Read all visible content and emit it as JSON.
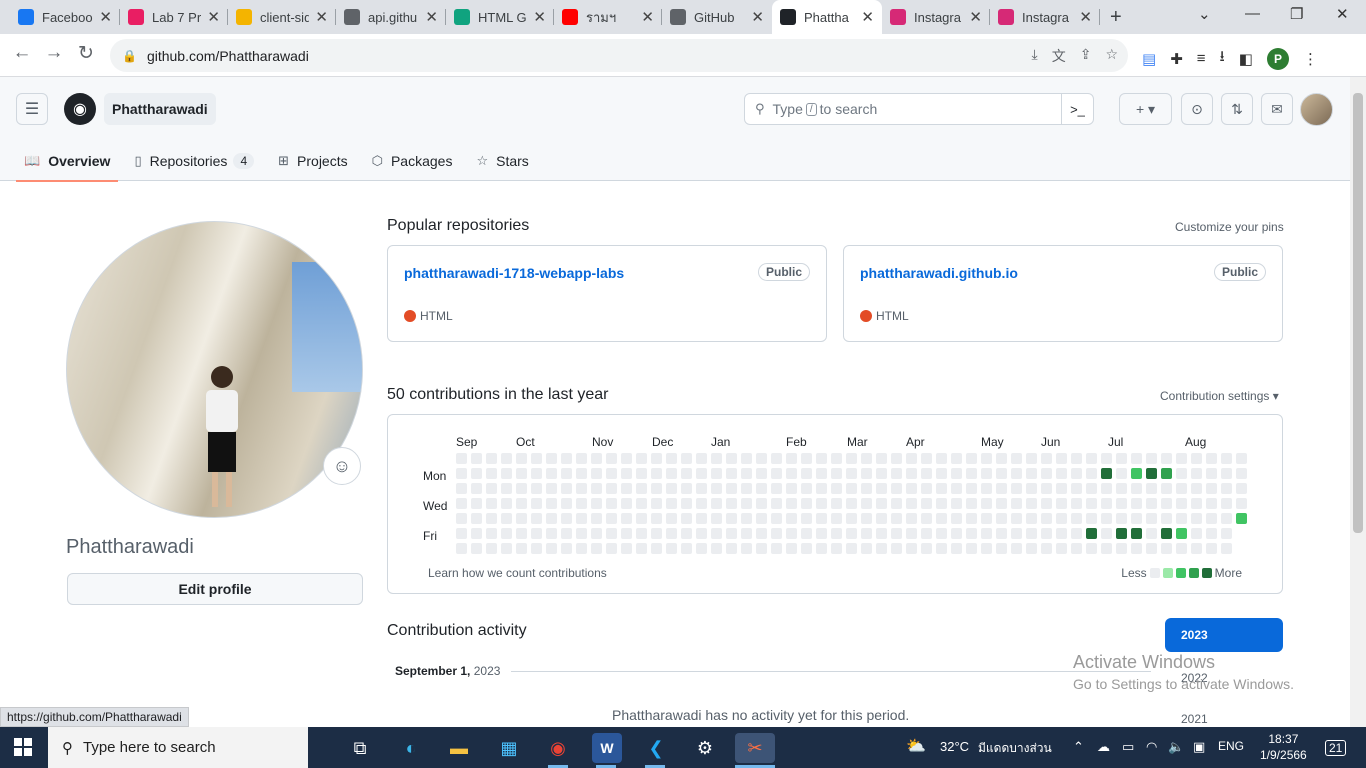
{
  "browser": {
    "tabs": [
      {
        "title": "Faceboo",
        "favicon": "facebook-icon",
        "color": "#1877f2"
      },
      {
        "title": "Lab 7 Pr",
        "favicon": "lab-icon",
        "color": "#e91e63"
      },
      {
        "title": "client-sid",
        "favicon": "slides-icon",
        "color": "#f4b400"
      },
      {
        "title": "api.githu",
        "favicon": "globe-icon",
        "color": "#5f6368"
      },
      {
        "title": "HTML G",
        "favicon": "chatgpt-icon",
        "color": "#10a37f"
      },
      {
        "title": "รามฯ",
        "favicon": "youtube-icon",
        "color": "#ff0000"
      },
      {
        "title": "GitHub",
        "favicon": "globe-icon",
        "color": "#5f6368"
      },
      {
        "title": "Phattha",
        "favicon": "github-icon",
        "color": "#1f2328"
      },
      {
        "title": "Instagra",
        "favicon": "instagram-icon",
        "color": "#d62976"
      },
      {
        "title": "Instagra",
        "favicon": "instagram-icon",
        "color": "#d62976"
      }
    ],
    "url": "github.com/Phattharawadi",
    "status_url": "https://github.com/Phattharawadi",
    "profile_initial": "P"
  },
  "header": {
    "username": "Phattharawadi",
    "search_prefix": "Type",
    "search_key": "/",
    "search_suffix": "to search",
    "new_label": "+"
  },
  "nav": {
    "overview": "Overview",
    "repositories": "Repositories",
    "repositories_count": "4",
    "projects": "Projects",
    "packages": "Packages",
    "stars": "Stars"
  },
  "profile": {
    "name": "Phattharawadi",
    "edit_label": "Edit profile"
  },
  "popular": {
    "title": "Popular repositories",
    "customize": "Customize your pins",
    "repos": [
      {
        "name": "phattharawadi-1718-webapp-labs",
        "visibility": "Public",
        "language": "HTML",
        "lang_color": "#e34c26"
      },
      {
        "name": "phattharawadi.github.io",
        "visibility": "Public",
        "language": "HTML",
        "lang_color": "#e34c26"
      }
    ]
  },
  "contrib": {
    "title": "50 contributions in the last year",
    "settings": "Contribution settings ▾",
    "months": [
      "Sep",
      "Oct",
      "Nov",
      "Dec",
      "Jan",
      "Feb",
      "Mar",
      "Apr",
      "May",
      "Jun",
      "Jul",
      "Aug"
    ],
    "days": [
      "Mon",
      "Wed",
      "Fri"
    ],
    "learn": "Learn how we count contributions",
    "less": "Less",
    "more": "More",
    "levels": [
      "#ebedf0",
      "#9be9a8",
      "#40c463",
      "#30a14e",
      "#216e39"
    ],
    "active_cells": [
      {
        "week": 43,
        "day": 1,
        "level": 4
      },
      {
        "week": 45,
        "day": 1,
        "level": 2
      },
      {
        "week": 46,
        "day": 1,
        "level": 4
      },
      {
        "week": 47,
        "day": 1,
        "level": 3
      },
      {
        "week": 52,
        "day": 4,
        "level": 2
      },
      {
        "week": 42,
        "day": 5,
        "level": 4
      },
      {
        "week": 44,
        "day": 5,
        "level": 4
      },
      {
        "week": 45,
        "day": 5,
        "level": 4
      },
      {
        "week": 47,
        "day": 5,
        "level": 4
      },
      {
        "week": 48,
        "day": 5,
        "level": 2
      }
    ]
  },
  "activity": {
    "title": "Contribution activity",
    "date": "September 1,",
    "year_inline": "2023",
    "empty": "Phattharawadi has no activity yet for this period.",
    "years": [
      "2023",
      "2022",
      "2021"
    ]
  },
  "watermark": {
    "line1": "Activate Windows",
    "line2": "Go to Settings to activate Windows."
  },
  "taskbar": {
    "search_placeholder": "Type here to search",
    "weather": "32°C",
    "weather_desc": "มีแดดบางส่วน",
    "lang": "ENG",
    "time": "18:37",
    "date": "1/9/2566",
    "notif_count": "21"
  }
}
